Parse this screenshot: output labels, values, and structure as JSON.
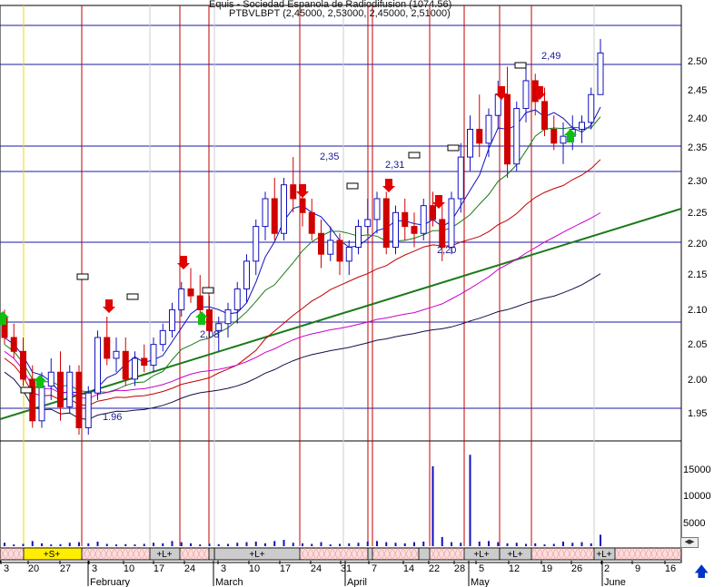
{
  "header": {
    "title": "Equis - Sociedad Espanola de Radiodifusion (1074.56)",
    "ohlc": "PTBVLBPT (2,45000, 2,53000, 2,45000, 2,51000)"
  },
  "chart_data": {
    "type": "candlestick",
    "ylim": [
      1.92,
      2.55
    ],
    "price_ticks": [
      "2.50",
      "2.45",
      "2.40",
      "2.35",
      "2.30",
      "2.25",
      "2.20",
      "2.15",
      "2.10",
      "2.05",
      "2.00",
      "1.95"
    ],
    "volume_ticks": [
      "15000",
      "10000",
      "5000"
    ],
    "date_ticks": [
      "3",
      "20",
      "27",
      "3",
      "10",
      "17",
      "24",
      "3",
      "10",
      "17",
      "24",
      "31",
      "7",
      "14",
      "22",
      "28",
      "5",
      "12",
      "19",
      "26",
      "2",
      "9",
      "16"
    ],
    "month_labels": [
      "February",
      "March",
      "April",
      "May",
      "June"
    ],
    "annotations": [
      "2,49",
      "2,35",
      "2,31",
      "2,20",
      "2,08",
      "1.96"
    ],
    "signal_bands": [
      "+S+",
      "+L+",
      "+L+",
      "+L+",
      "+L+",
      "+L+"
    ],
    "candles": [
      [
        2.13,
        2.14,
        2.09,
        2.1
      ],
      [
        2.1,
        2.12,
        2.07,
        2.08
      ],
      [
        2.08,
        2.1,
        2.03,
        2.04
      ],
      [
        2.04,
        2.06,
        1.97,
        1.98
      ],
      [
        1.98,
        2.05,
        1.97,
        2.03
      ],
      [
        2.03,
        2.07,
        2.01,
        2.05
      ],
      [
        2.05,
        2.08,
        1.98,
        2.0
      ],
      [
        2.0,
        2.06,
        1.99,
        2.05
      ],
      [
        2.05,
        2.06,
        1.96,
        1.97
      ],
      [
        1.97,
        2.03,
        1.96,
        2.02
      ],
      [
        2.02,
        2.11,
        2.01,
        2.1
      ],
      [
        2.1,
        2.13,
        2.06,
        2.07
      ],
      [
        2.07,
        2.1,
        2.05,
        2.08
      ],
      [
        2.08,
        2.1,
        2.03,
        2.04
      ],
      [
        2.04,
        2.08,
        2.03,
        2.07
      ],
      [
        2.07,
        2.09,
        2.05,
        2.06
      ],
      [
        2.06,
        2.1,
        2.05,
        2.09
      ],
      [
        2.09,
        2.12,
        2.08,
        2.11
      ],
      [
        2.11,
        2.15,
        2.1,
        2.14
      ],
      [
        2.14,
        2.18,
        2.13,
        2.17
      ],
      [
        2.17,
        2.2,
        2.15,
        2.16
      ],
      [
        2.16,
        2.19,
        2.13,
        2.14
      ],
      [
        2.14,
        2.16,
        2.1,
        2.11
      ],
      [
        2.11,
        2.13,
        2.08,
        2.12
      ],
      [
        2.12,
        2.15,
        2.1,
        2.14
      ],
      [
        2.14,
        2.18,
        2.12,
        2.17
      ],
      [
        2.17,
        2.22,
        2.15,
        2.21
      ],
      [
        2.21,
        2.27,
        2.19,
        2.26
      ],
      [
        2.26,
        2.31,
        2.24,
        2.3
      ],
      [
        2.3,
        2.33,
        2.24,
        2.25
      ],
      [
        2.25,
        2.33,
        2.24,
        2.32
      ],
      [
        2.32,
        2.36,
        2.28,
        2.3
      ],
      [
        2.3,
        2.32,
        2.26,
        2.28
      ],
      [
        2.28,
        2.3,
        2.24,
        2.25
      ],
      [
        2.25,
        2.27,
        2.2,
        2.22
      ],
      [
        2.22,
        2.26,
        2.21,
        2.24
      ],
      [
        2.24,
        2.25,
        2.19,
        2.21
      ],
      [
        2.21,
        2.24,
        2.19,
        2.23
      ],
      [
        2.23,
        2.27,
        2.22,
        2.26
      ],
      [
        2.26,
        2.3,
        2.25,
        2.27
      ],
      [
        2.27,
        2.31,
        2.25,
        2.3
      ],
      [
        2.3,
        2.31,
        2.22,
        2.23
      ],
      [
        2.23,
        2.29,
        2.22,
        2.28
      ],
      [
        2.28,
        2.3,
        2.24,
        2.26
      ],
      [
        2.26,
        2.28,
        2.23,
        2.25
      ],
      [
        2.25,
        2.3,
        2.24,
        2.29
      ],
      [
        2.29,
        2.31,
        2.26,
        2.27
      ],
      [
        2.27,
        2.29,
        2.21,
        2.23
      ],
      [
        2.23,
        2.31,
        2.22,
        2.3
      ],
      [
        2.3,
        2.38,
        2.28,
        2.36
      ],
      [
        2.36,
        2.42,
        2.34,
        2.4
      ],
      [
        2.4,
        2.45,
        2.36,
        2.38
      ],
      [
        2.38,
        2.43,
        2.36,
        2.42
      ],
      [
        2.42,
        2.47,
        2.4,
        2.45
      ],
      [
        2.45,
        2.49,
        2.33,
        2.35
      ],
      [
        2.35,
        2.44,
        2.34,
        2.43
      ],
      [
        2.43,
        2.49,
        2.41,
        2.47
      ],
      [
        2.47,
        2.48,
        2.42,
        2.44
      ],
      [
        2.44,
        2.46,
        2.39,
        2.4
      ],
      [
        2.4,
        2.42,
        2.37,
        2.38
      ],
      [
        2.38,
        2.41,
        2.35,
        2.39
      ],
      [
        2.39,
        2.42,
        2.37,
        2.4
      ],
      [
        2.4,
        2.42,
        2.38,
        2.41
      ],
      [
        2.41,
        2.46,
        2.4,
        2.45
      ],
      [
        2.45,
        2.53,
        2.45,
        2.51
      ]
    ],
    "volume": [
      600,
      300,
      400,
      900,
      500,
      300,
      350,
      600,
      700,
      500,
      800,
      400,
      300,
      350,
      300,
      400,
      600,
      500,
      900,
      700,
      500,
      300,
      450,
      350,
      400,
      600,
      700,
      800,
      500,
      900,
      1100,
      600,
      500,
      400,
      700,
      300,
      400,
      500,
      600,
      800,
      900,
      700,
      600,
      500,
      700,
      800,
      14000,
      1600,
      700,
      600,
      16000,
      800,
      900,
      700,
      500,
      600,
      400,
      500,
      300,
      400,
      800,
      600,
      700,
      500,
      2000
    ]
  }
}
